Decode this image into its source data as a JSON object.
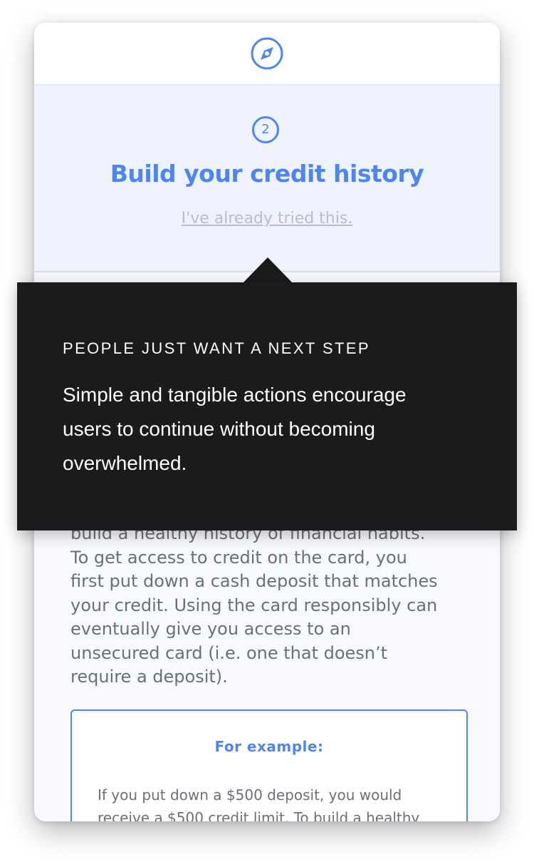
{
  "header": {
    "icon": "compass-icon"
  },
  "step": {
    "number": "2",
    "title": "Build your credit history",
    "already_tried_link": "I've already tried this."
  },
  "content": {
    "body_lines": [
      "build a healthy history of financial habits.",
      "To get access to credit on the card, you",
      "first put down a cash deposit that matches",
      "your credit. Using the card responsibly can",
      "eventually give you access to an",
      "unsecured card (i.e. one that doesn’t",
      "require a deposit)."
    ],
    "example": {
      "title": "For example:",
      "lines": [
        "If you put down a $500 deposit, you would",
        "receive a $500 credit limit. To build a healthy"
      ]
    }
  },
  "tooltip": {
    "heading": "PEOPLE JUST WANT A NEXT STEP",
    "body_lines": [
      "Simple and tangible actions encourage",
      "users to continue without becoming",
      "overwhelmed."
    ]
  },
  "colors": {
    "accent": "#4f86ee",
    "tooltip_bg": "#1b1b1d",
    "step_bg": "#edf2fd",
    "body_text": "#6b6f78",
    "muted_link": "#b8bdc7"
  }
}
